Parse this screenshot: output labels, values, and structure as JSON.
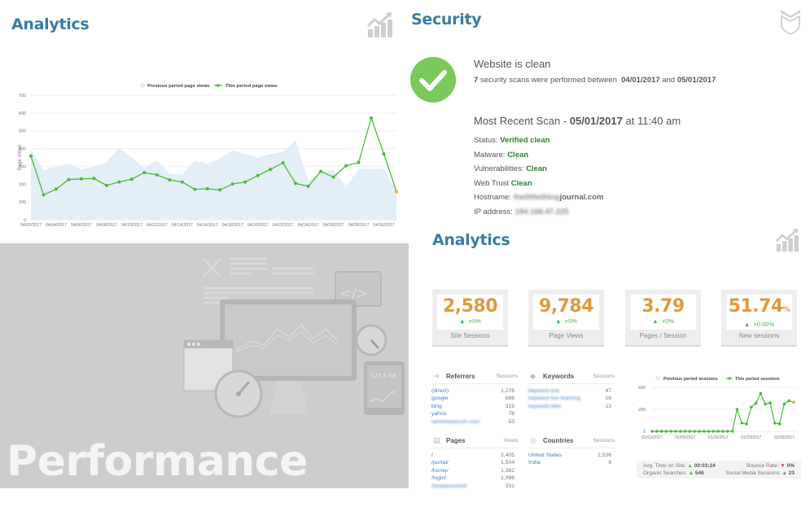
{
  "analytics_top": {
    "title": "Analytics",
    "icon": "analytics-chart-icon"
  },
  "security": {
    "title": "Security",
    "icon": "shield-icon",
    "status_icon": "check-circle-icon",
    "headline": "Website is clean",
    "scan_count": "7",
    "scan_text": "security scans were performed between",
    "start_date": "04/01/2017",
    "and_text": "and",
    "end_date": "05/01/2017",
    "recent_label": "Most Recent Scan -",
    "recent_date": "05/01/2017",
    "recent_time": "at 11:40 am",
    "rows": [
      {
        "label": "Status:",
        "value": "Verified clean"
      },
      {
        "label": "Malware:",
        "value": "Clean"
      },
      {
        "label": "Vulnerabilities:",
        "value": "Clean"
      },
      {
        "label": "Web Trust",
        "value": "Clean"
      }
    ],
    "hostname_label": "Hostname:",
    "hostname_blurred": "thelittlething",
    "hostname_suffix": "journal.com",
    "ip_label": "IP address:",
    "ip_blurred": "184.168.47.225"
  },
  "performance": {
    "title": "Performance",
    "illustration_text": "127.5 KB"
  },
  "analytics_bottom": {
    "title": "Analytics",
    "icon": "analytics-chart-icon",
    "cards": [
      {
        "value": "2,580",
        "suffix": "",
        "delta": "+0%",
        "label": "Site Sessions"
      },
      {
        "value": "9,784",
        "suffix": "",
        "delta": "+0%",
        "label": "Page Views"
      },
      {
        "value": "3.79",
        "suffix": "",
        "delta": "+0%",
        "label": "Pages / Session"
      },
      {
        "value": "51.74",
        "suffix": "%",
        "delta": "+0.00%",
        "label": "New sessions"
      }
    ],
    "referrers": {
      "title": "Referrers",
      "col": "Sessions",
      "rows": [
        {
          "key": "(direct)",
          "value": "1,276"
        },
        {
          "key": "google",
          "value": "688"
        },
        {
          "key": "bing",
          "value": "319"
        },
        {
          "key": "yahoo",
          "value": "78"
        },
        {
          "key": "sendsharecom.com",
          "value": "53",
          "blurred": true
        }
      ]
    },
    "keywords": {
      "title": "Keywords",
      "col": "Sessions",
      "rows": [
        {
          "key": "keyword one",
          "value": "47",
          "blurred": true
        },
        {
          "key": "keyword two learning",
          "value": "16",
          "blurred": true
        },
        {
          "key": "keyword ohio",
          "value": "13",
          "blurred": true
        }
      ]
    },
    "pages": {
      "title": "Pages",
      "col": "Views",
      "rows": [
        {
          "key": "/",
          "value": "2,405"
        },
        {
          "key": "/portal/",
          "value": "1,504"
        },
        {
          "key": "/home/",
          "value": "1,382"
        },
        {
          "key": "/login/",
          "value": "1,096"
        },
        {
          "key": "/lostpassword/",
          "value": "331",
          "blurred": true
        }
      ]
    },
    "countries": {
      "title": "Countries",
      "col": "Sessions",
      "rows": [
        {
          "key": "United States",
          "value": "2,536"
        },
        {
          "key": "India",
          "value": "9"
        }
      ]
    },
    "footer": {
      "avg_time_label": "Avg. Time on Site:",
      "avg_time": "00:03:24",
      "bounce_label": "Bounce Rate:",
      "bounce": "0%",
      "organic_label": "Organic Searches:",
      "organic": "546",
      "social_label": "Social Media Sessions:",
      "social": "23"
    }
  },
  "chart_data": [
    {
      "type": "line",
      "title": "",
      "xlabel": "",
      "ylabel": "Page Views",
      "ylim": [
        0,
        700
      ],
      "yticks": [
        0,
        100,
        200,
        300,
        400,
        500,
        600,
        700
      ],
      "grid": true,
      "legend": "top-center",
      "x": [
        "04/02/2017",
        "04/03/2017",
        "04/04/2017",
        "04/05/2017",
        "04/06/2017",
        "04/07/2017",
        "04/08/2017",
        "04/09/2017",
        "04/10/2017",
        "04/11/2017",
        "04/12/2017",
        "04/13/2017",
        "04/14/2017",
        "04/15/2017",
        "04/16/2017",
        "04/17/2017",
        "04/18/2017",
        "04/19/2017",
        "04/20/2017",
        "04/21/2017",
        "04/22/2017",
        "04/23/2017",
        "04/24/2017",
        "04/25/2017",
        "04/26/2017",
        "04/27/2017",
        "04/28/2017",
        "04/29/2017",
        "04/30/2017",
        "05/01/2017"
      ],
      "xtick_labels": [
        "04/02/2017",
        "04/04/2017",
        "04/06/2017",
        "04/08/2017",
        "04/10/2017",
        "04/12/2017",
        "04/14/2017",
        "04/16/2017",
        "04/18/2017",
        "04/20/2017",
        "04/22/2017",
        "04/24/2017",
        "04/26/2017",
        "04/28/2017",
        "04/30/2017"
      ],
      "series": [
        {
          "name": "Previous period page views",
          "kind": "area",
          "color": "#e3eef7",
          "values": [
            395,
            280,
            297,
            315,
            283,
            298,
            325,
            405,
            350,
            288,
            335,
            258,
            254,
            332,
            315,
            345,
            390,
            370,
            352,
            368,
            382,
            445,
            222,
            270,
            280,
            183,
            288,
            286,
            288,
            158
          ]
        },
        {
          "name": "This period page views",
          "kind": "line",
          "color": "#4cbb3a",
          "last_point_color": "#f5a623",
          "values": [
            358,
            140,
            172,
            226,
            230,
            232,
            193,
            212,
            228,
            265,
            252,
            224,
            212,
            171,
            174,
            168,
            201,
            212,
            248,
            283,
            320,
            204,
            188,
            272,
            240,
            303,
            322,
            572,
            370,
            158
          ]
        }
      ]
    },
    {
      "type": "line",
      "title": "",
      "xlabel": "",
      "ylabel": "",
      "ylim": [
        0,
        400
      ],
      "yticks": [
        0,
        200,
        400
      ],
      "grid": true,
      "legend": "top-center",
      "x_count": 31,
      "xtick_labels": [
        "01/02/2017",
        "01/09/2017",
        "01/16/2017",
        "01/23/2017",
        "01/30/2017"
      ],
      "xtick_index": [
        0,
        7,
        14,
        21,
        28
      ],
      "series": [
        {
          "name": "Previous period sessions",
          "kind": "area",
          "color": "#e3eef7",
          "values": []
        },
        {
          "name": "This period sessions",
          "kind": "line",
          "color": "#4cbb3a",
          "last_point_color": "#f5a623",
          "values": [
            0,
            0,
            0,
            0,
            0,
            0,
            0,
            0,
            0,
            0,
            0,
            0,
            0,
            0,
            0,
            0,
            0,
            0,
            200,
            75,
            68,
            220,
            255,
            345,
            248,
            258,
            75,
            68,
            250,
            278,
            265
          ]
        }
      ]
    }
  ]
}
